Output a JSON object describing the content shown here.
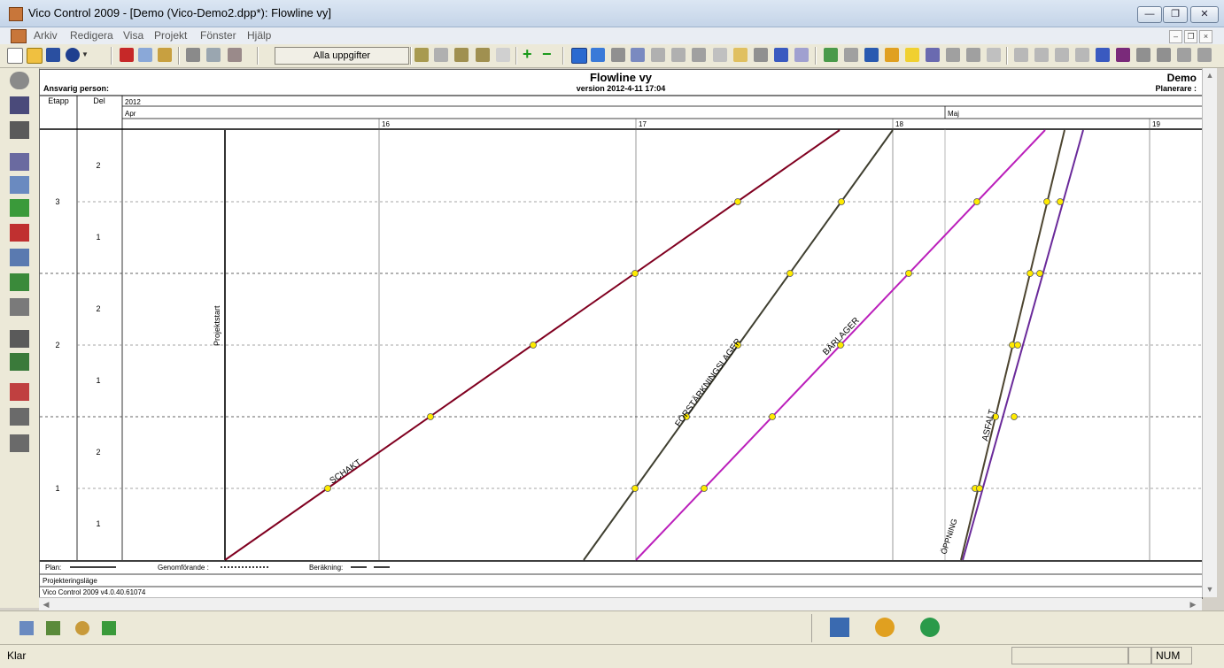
{
  "window": {
    "title": "Vico Control 2009 - [Demo (Vico-Demo2.dpp*): Flowline vy]",
    "controls": [
      "—",
      "❐",
      "✕"
    ]
  },
  "menu": [
    "Arkiv",
    "Redigera",
    "Visa",
    "Projekt",
    "Fönster",
    "Hjälp"
  ],
  "mdi_controls": [
    "–",
    "❐",
    "×"
  ],
  "toolbar": {
    "filter_button": "Alla uppgifter"
  },
  "header": {
    "title": "Flowline vy",
    "version": "version 2012-4-11 17:04",
    "project": "Demo",
    "responsible": "Ansvarig person:",
    "planner": "Planerare :"
  },
  "columns": {
    "etapp": "Etapp",
    "del": "Del"
  },
  "timeline": {
    "year": "2012",
    "months": [
      "Apr",
      "Maj"
    ],
    "weeks": [
      "16",
      "17",
      "18",
      "19"
    ]
  },
  "rows": {
    "etapp": [
      "3",
      "2",
      "1"
    ],
    "del": [
      "2",
      "1",
      "2",
      "1",
      "2",
      "1"
    ]
  },
  "milestone": {
    "label": "Projektstart"
  },
  "tasks": [
    {
      "name": "SCHAKT",
      "color": "#800020"
    },
    {
      "name": "FÖRSTÄRKNINGSLAGER",
      "color": "#3f3f30"
    },
    {
      "name": "BÄRLAGER",
      "color": "#bb1fbb"
    },
    {
      "name": "ASFALT",
      "color": "#4d4530"
    },
    {
      "name": "ÖPPNING",
      "color": "#6a2a9a"
    }
  ],
  "marker_color": "#ffeb00",
  "legend": {
    "plan": "Plan:",
    "genomforande": "Genomförande :",
    "berakning": "Beräkning:"
  },
  "footer": {
    "mode": "Projekteringsläge",
    "version": "Vico Control 2009 v4.0.40.61074"
  },
  "status": {
    "text": "Klar",
    "num": "NUM"
  }
}
